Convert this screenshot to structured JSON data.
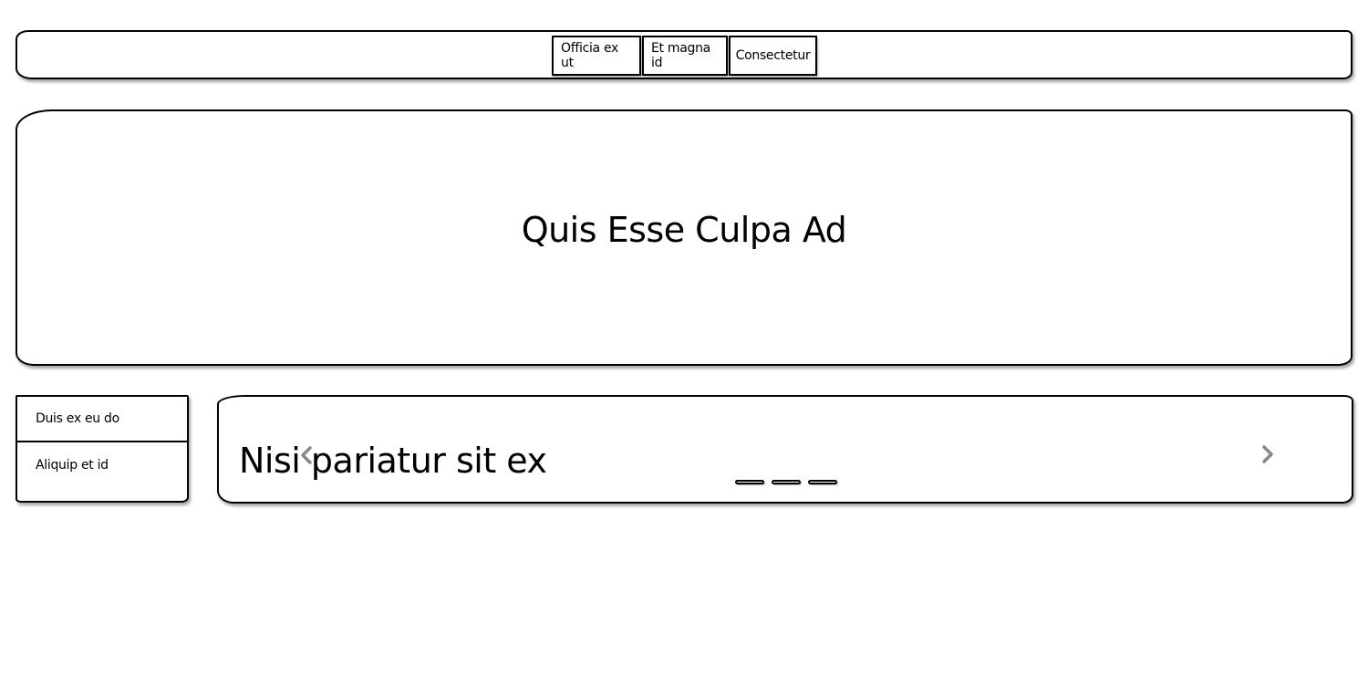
{
  "navbar": {
    "buttons": [
      {
        "label": "Officia ex ut"
      },
      {
        "label": "Et magna id"
      },
      {
        "label": "Consectetur"
      }
    ]
  },
  "hero": {
    "title": "Quis Esse Culpa Ad"
  },
  "sidelist": {
    "items": [
      {
        "label": "Duis ex eu do"
      },
      {
        "label": "Aliquip et id"
      }
    ]
  },
  "carousel": {
    "slide_text": "Nisi pariatur sit ex",
    "prev_icon": "chevron-left-icon",
    "next_icon": "chevron-right-icon",
    "arrow_color": "#888888",
    "indicator_count": 3
  }
}
